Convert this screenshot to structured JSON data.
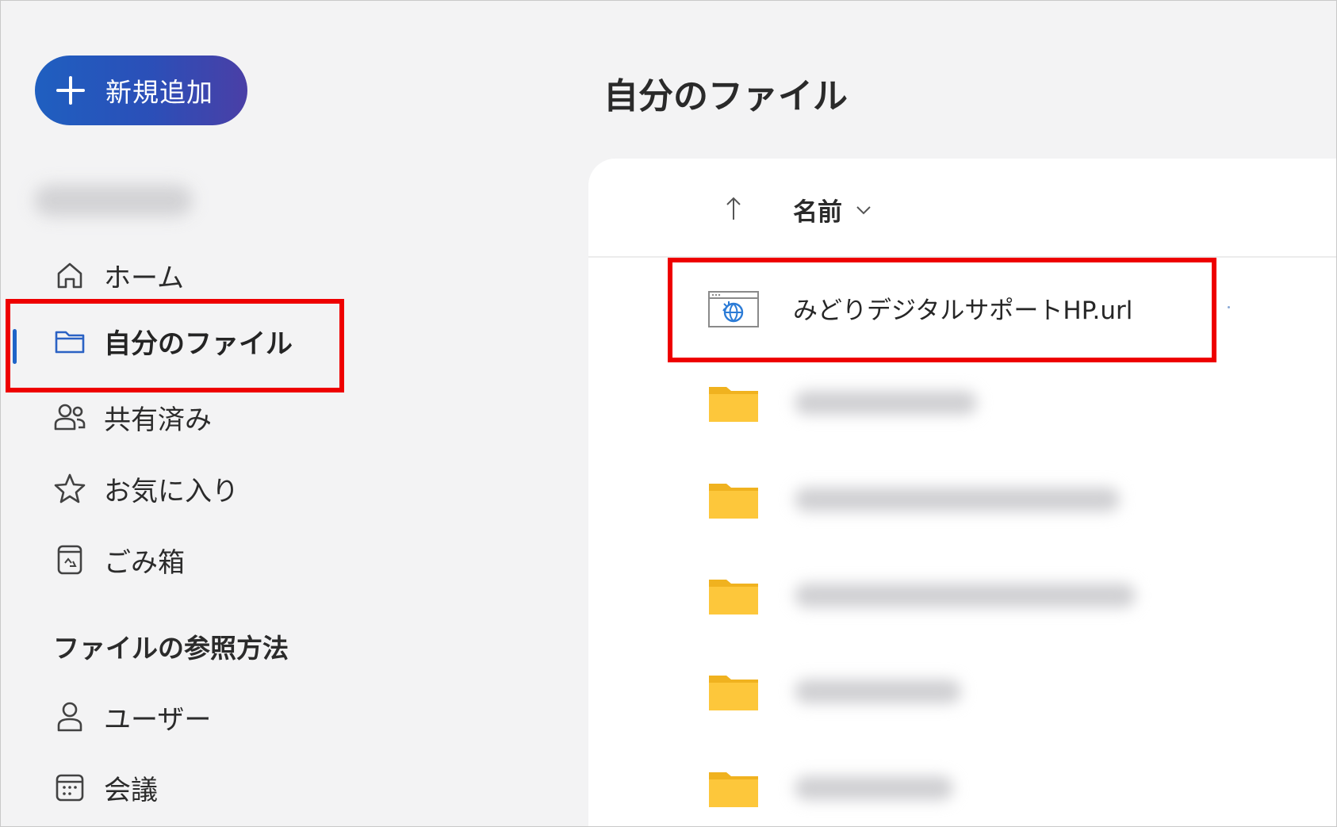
{
  "sidebar": {
    "new_button": {
      "label": "新規追加",
      "icon": "plus-icon"
    },
    "nav_items": [
      {
        "label": "ホーム",
        "icon": "home-icon"
      },
      {
        "label": "自分のファイル",
        "icon": "folder-icon",
        "active": true
      },
      {
        "label": "共有済み",
        "icon": "people-icon"
      },
      {
        "label": "お気に入り",
        "icon": "star-icon"
      },
      {
        "label": "ごみ箱",
        "icon": "recycle-bin-icon"
      }
    ],
    "browse_section": {
      "title": "ファイルの参照方法",
      "items": [
        {
          "label": "ユーザー",
          "icon": "person-icon"
        },
        {
          "label": "会議",
          "icon": "calendar-icon"
        }
      ]
    }
  },
  "main": {
    "title": "自分のファイル",
    "column_header": {
      "name_label": "名前",
      "sort_icon": "sort-up-arrow-icon",
      "dropdown_icon": "chevron-down-icon"
    },
    "files": [
      {
        "name": "みどりデジタルサポートHP.url",
        "icon": "url-shortcut-icon"
      }
    ],
    "blurred_folder_icon": "folder-icon"
  },
  "colors": {
    "accent": "#1f64c8",
    "highlight": "#ee0000",
    "folder": "#f5bd2b",
    "button_gradient_start": "#1f5fc0",
    "button_gradient_end": "#4a3fa6"
  }
}
